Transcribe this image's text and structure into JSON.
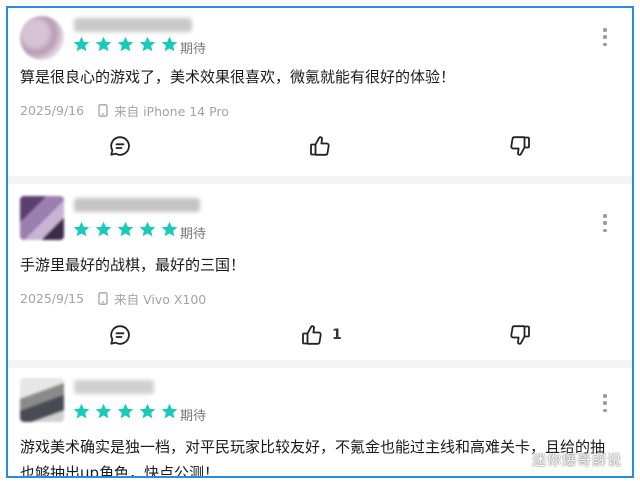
{
  "colors": {
    "border": "#2a8be6",
    "star": "#19c9b9",
    "text": "#1b1b1b",
    "meta": "#a3a3a3",
    "divider": "#f2f3f5"
  },
  "reviews": [
    {
      "rating": 5,
      "status": "期待",
      "text": "算是很良心的游戏了，美术效果很喜欢，微氪就能有很好的体验！",
      "date": "2025/9/16",
      "device": "来自 iPhone 14 Pro",
      "likes": ""
    },
    {
      "rating": 5,
      "status": "期待",
      "text": "手游里最好的战棋，最好的三国！",
      "date": "2025/9/15",
      "device": "来自 Vivo X100",
      "likes": "1"
    },
    {
      "rating": 5,
      "status": "期待",
      "text": "游戏美术确实是独一档，对平民玩家比较友好，不氪金也能过主线和高难关卡，且给的抽也够抽出up角色，快点公测！",
      "date": "",
      "device": "",
      "likes": ""
    }
  ],
  "icons": {
    "more": "more-vertical-icon",
    "comment": "comment-icon",
    "like": "thumbs-up-icon",
    "dislike": "thumbs-down-icon",
    "phone": "phone-icon",
    "star": "star-icon"
  },
  "watermark": "迷你爆哥解说"
}
